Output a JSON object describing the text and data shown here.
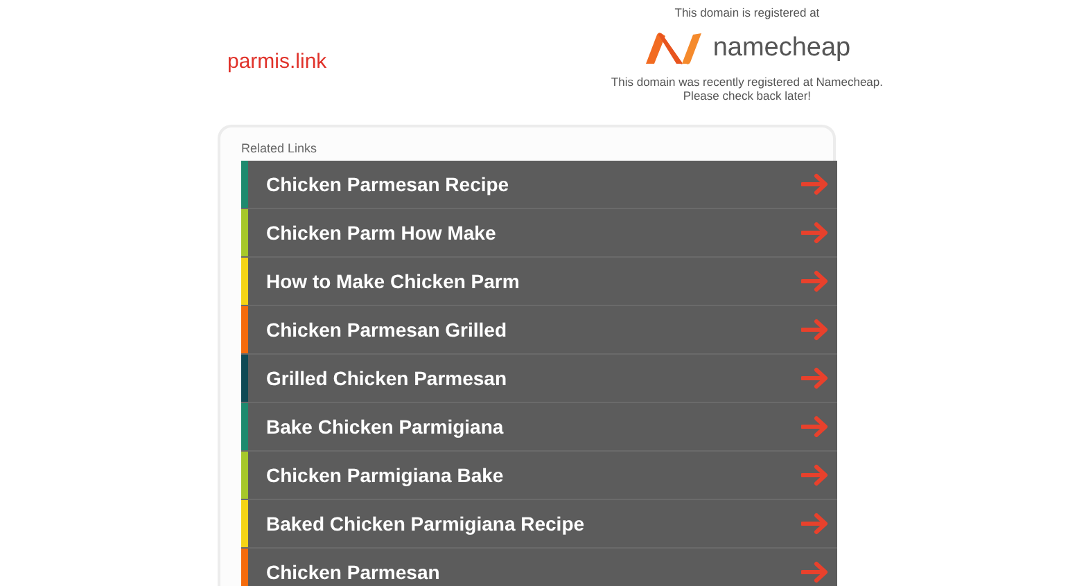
{
  "site": {
    "domain": "parmis.link"
  },
  "registrar": {
    "caption": "This domain is registered at",
    "name": "namecheap",
    "notice": [
      "This domain was recently registered at Namecheap.",
      "Please check back later!"
    ]
  },
  "related_links": {
    "heading": "Related Links",
    "items": [
      {
        "label": "Chicken Parmesan Recipe",
        "color": "#1e8a6e"
      },
      {
        "label": "Chicken Parm How Make",
        "color": "#a6c82a"
      },
      {
        "label": "How to Make Chicken Parm",
        "color": "#f5d415"
      },
      {
        "label": "Chicken Parmesan Grilled",
        "color": "#f56b0c"
      },
      {
        "label": "Grilled Chicken Parmesan",
        "color": "#0f4a55"
      },
      {
        "label": "Bake Chicken Parmigiana",
        "color": "#1e8a6e"
      },
      {
        "label": "Chicken Parmigiana Bake",
        "color": "#a6c82a"
      },
      {
        "label": "Baked Chicken Parmigiana Recipe",
        "color": "#f5d415"
      },
      {
        "label": "Chicken Parmesan",
        "color": "#f56b0c"
      }
    ]
  }
}
